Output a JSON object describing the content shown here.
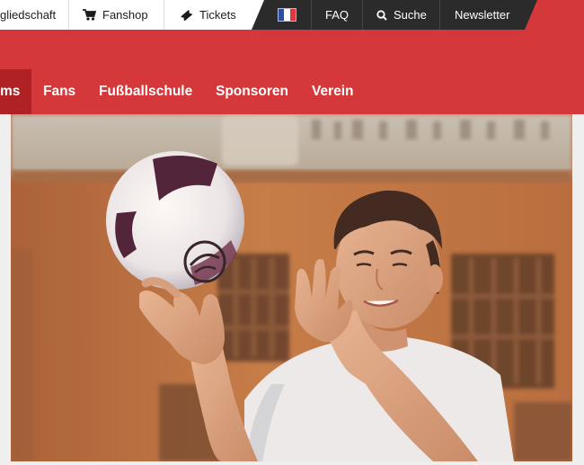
{
  "topbar": {
    "membership_label": "gliedschaft",
    "fanshop_label": "Fanshop",
    "tickets_label": "Tickets",
    "language_flag_colors": [
      "#2a4ea3",
      "#ffffff",
      "#e0363d"
    ],
    "faq_label": "FAQ",
    "search_label": "Suche",
    "newsletter_label": "Newsletter",
    "icons": [
      "cart-icon",
      "ticket-icon",
      "france-flag-icon",
      "search-icon"
    ]
  },
  "nav": {
    "items": [
      {
        "label": "ms",
        "active": true
      },
      {
        "label": "Fans",
        "active": false
      },
      {
        "label": "Fußballschule",
        "active": false
      },
      {
        "label": "Sponsoren",
        "active": false
      },
      {
        "label": "Verein",
        "active": false
      }
    ]
  },
  "hero": {
    "description_icon": "soccer-player-photo"
  },
  "colors": {
    "brand_red": "#d5383a",
    "active_nav": "#b02124",
    "topbar_dark": "#2b2b2b"
  }
}
